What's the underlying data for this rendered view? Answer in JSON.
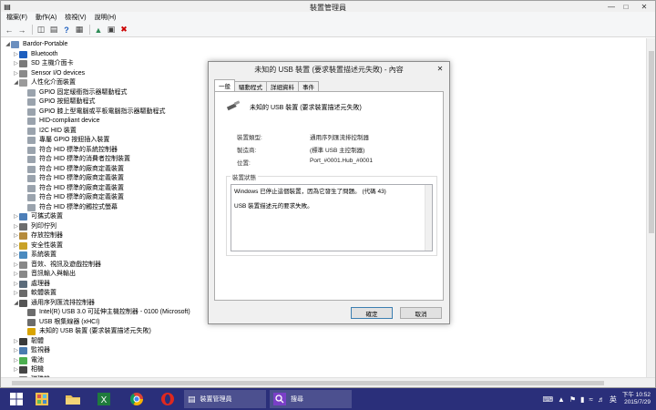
{
  "window": {
    "title": "裝置管理員"
  },
  "menu": [
    "檔案(F)",
    "動作(A)",
    "檢視(V)",
    "說明(H)"
  ],
  "tree": [
    {
      "level": 0,
      "expanded": true,
      "label": "Bardor-Portable",
      "icon": "computer-icon",
      "color": "#6b8fbf"
    },
    {
      "level": 1,
      "expanded": false,
      "label": "Bluetooth",
      "icon": "bluetooth-icon",
      "color": "#1e5fbf"
    },
    {
      "level": 1,
      "expanded": false,
      "label": "SD 主機介面卡",
      "icon": "sd-host-icon",
      "color": "#7a7a7a"
    },
    {
      "level": 1,
      "expanded": false,
      "label": "Sensor I/O devices",
      "icon": "sensor-icon",
      "color": "#8a8a8a"
    },
    {
      "level": 1,
      "expanded": true,
      "label": "人性化介面裝置",
      "icon": "hid-icon",
      "color": "#9a9a9a"
    },
    {
      "level": 2,
      "label": "GPIO 固定緩衝指示器驅動程式",
      "icon": "hid-device-icon",
      "color": "#9aa3ad"
    },
    {
      "level": 2,
      "label": "GPIO 按鈕驅動程式",
      "icon": "hid-device-icon",
      "color": "#9aa3ad"
    },
    {
      "level": 2,
      "label": "GPIO 膝上型電腦或平板電腦指示器驅動程式",
      "icon": "hid-device-icon",
      "color": "#9aa3ad"
    },
    {
      "level": 2,
      "label": "HID-compliant device",
      "icon": "hid-device-icon",
      "color": "#9aa3ad"
    },
    {
      "level": 2,
      "label": "I2C HID 裝置",
      "icon": "hid-device-icon",
      "color": "#9aa3ad"
    },
    {
      "level": 2,
      "label": "專屬 GPIO 按鈕插入裝置",
      "icon": "hid-device-icon",
      "color": "#9aa3ad"
    },
    {
      "level": 2,
      "label": "符合 HID 標準的系統控制器",
      "icon": "hid-device-icon",
      "color": "#9aa3ad"
    },
    {
      "level": 2,
      "label": "符合 HID 標準的消費者控制裝置",
      "icon": "hid-device-icon",
      "color": "#9aa3ad"
    },
    {
      "level": 2,
      "label": "符合 HID 標準的廠商定義裝置",
      "icon": "hid-device-icon",
      "color": "#9aa3ad"
    },
    {
      "level": 2,
      "label": "符合 HID 標準的廠商定義裝置",
      "icon": "hid-device-icon",
      "color": "#9aa3ad"
    },
    {
      "level": 2,
      "label": "符合 HID 標準的廠商定義裝置",
      "icon": "hid-device-icon",
      "color": "#9aa3ad"
    },
    {
      "level": 2,
      "label": "符合 HID 標準的廠商定義裝置",
      "icon": "hid-device-icon",
      "color": "#9aa3ad"
    },
    {
      "level": 2,
      "label": "符合 HID 標準的觸控式螢幕",
      "icon": "hid-device-icon",
      "color": "#9aa3ad"
    },
    {
      "level": 1,
      "expanded": false,
      "label": "可攜式裝置",
      "icon": "portable-device-icon",
      "color": "#4d7fb8"
    },
    {
      "level": 1,
      "expanded": false,
      "label": "列印佇列",
      "icon": "printer-icon",
      "color": "#6d6d6d"
    },
    {
      "level": 1,
      "expanded": false,
      "label": "存放控制器",
      "icon": "storage-icon",
      "color": "#b58b3c"
    },
    {
      "level": 1,
      "expanded": false,
      "label": "安全性裝置",
      "icon": "security-icon",
      "color": "#c9a227"
    },
    {
      "level": 1,
      "expanded": false,
      "label": "系統裝置",
      "icon": "system-icon",
      "color": "#4a8abf"
    },
    {
      "level": 1,
      "expanded": false,
      "label": "音效、視訊及遊戲控制器",
      "icon": "audio-icon",
      "color": "#888888"
    },
    {
      "level": 1,
      "expanded": false,
      "label": "音訊輸入與輸出",
      "icon": "speaker-icon",
      "color": "#888888"
    },
    {
      "level": 1,
      "expanded": false,
      "label": "處理器",
      "icon": "processor-icon",
      "color": "#5b6b7a"
    },
    {
      "level": 1,
      "expanded": false,
      "label": "軟體裝置",
      "icon": "software-icon",
      "color": "#6a6a6a"
    },
    {
      "level": 1,
      "expanded": true,
      "label": "通用序列匯流排控制器",
      "icon": "usb-icon",
      "color": "#555555"
    },
    {
      "level": 2,
      "label": "Intel(R) USB 3.0 可延伸主機控制器 - 0100 (Microsoft)",
      "icon": "usb-device-icon",
      "color": "#6c6c6c"
    },
    {
      "level": 2,
      "label": "USB 根集線器 (xHCI)",
      "icon": "usb-device-icon",
      "color": "#6c6c6c"
    },
    {
      "level": 2,
      "label": "未知的 USB 裝置 (要求裝置描述元失敗)",
      "icon": "usb-warning-icon",
      "color": "#d9a400"
    },
    {
      "level": 1,
      "expanded": false,
      "label": "韌體",
      "icon": "firmware-icon",
      "color": "#3a3a3a"
    },
    {
      "level": 1,
      "expanded": false,
      "label": "監視器",
      "icon": "monitor-icon",
      "color": "#4a7bb0"
    },
    {
      "level": 1,
      "expanded": false,
      "label": "電池",
      "icon": "battery-icon",
      "color": "#4caf50"
    },
    {
      "level": 1,
      "expanded": false,
      "label": "相機",
      "icon": "camera-icon",
      "color": "#444444"
    },
    {
      "level": 1,
      "expanded": false,
      "label": "磁碟機",
      "icon": "disk-icon",
      "color": "#777777"
    },
    {
      "level": 1,
      "expanded": false,
      "label": "網路介面",
      "icon": "network-icon",
      "color": "#5a7ea8"
    }
  ],
  "dialog": {
    "title": "未知的 USB 裝置 (要求裝置描述元失敗) - 內容",
    "tabs": [
      "一般",
      "驅動程式",
      "詳細資料",
      "事件"
    ],
    "device_name": "未知的 USB 裝置 (要求裝置描述元失敗)",
    "props": [
      {
        "label": "裝置類型:",
        "value": "通用序列匯流排控制器"
      },
      {
        "label": "製造商:",
        "value": "(標準 USB 主控制器)"
      },
      {
        "label": "位置:",
        "value": "Port_#0001.Hub_#0001"
      }
    ],
    "status_label": "裝置狀態",
    "status_lines": [
      "Windows 已停止這個裝置，因為它發生了問題。 (代碼 43)",
      "USB 裝置描述元的要求失敗。"
    ],
    "ok": "確定",
    "cancel": "取消"
  },
  "taskbar": {
    "windows": [
      {
        "label": "裝置管理員"
      },
      {
        "label": "搜尋"
      }
    ],
    "time": "下午 10:52",
    "date": "2015/7/29"
  }
}
